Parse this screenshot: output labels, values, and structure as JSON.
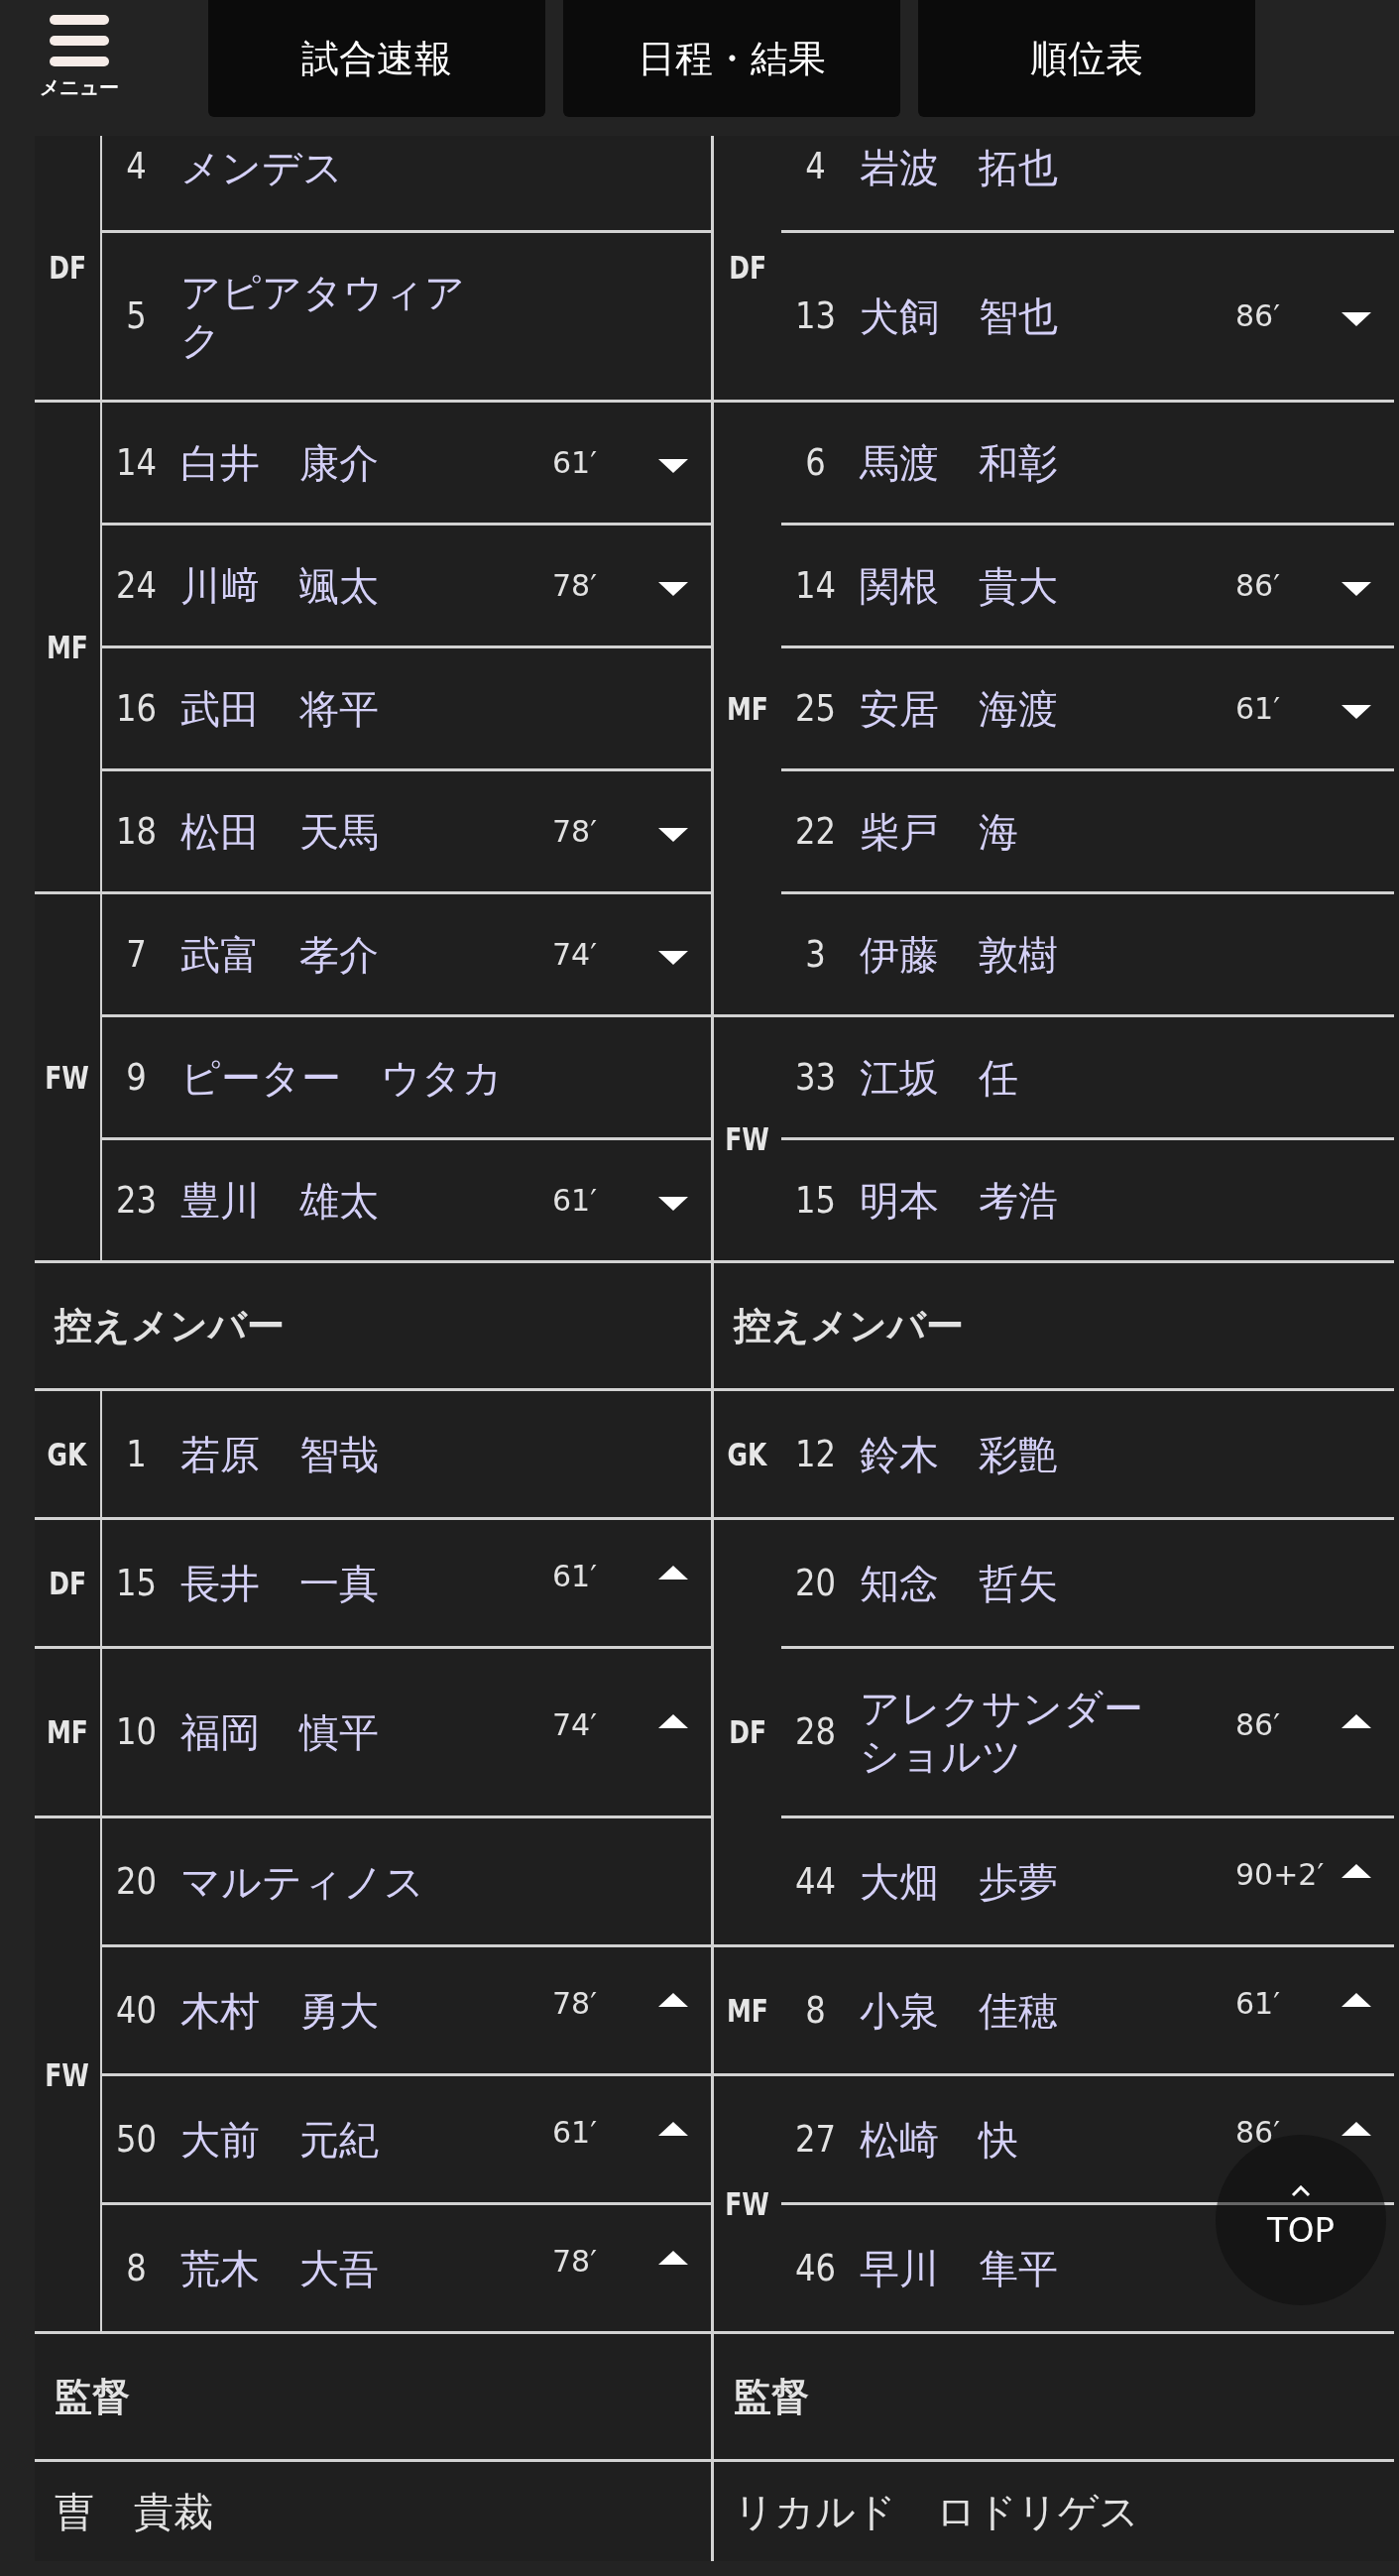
{
  "header": {
    "menu_label": "メニュー",
    "nav": [
      "試合速報",
      "日程・結果",
      "順位表"
    ]
  },
  "teams": [
    {
      "starters": [
        {
          "position": "DF",
          "players": [
            {
              "number": "4",
              "name": "メンデス",
              "substituted": false
            },
            {
              "number": "5",
              "name_lines": [
                "アピアタウィア",
                "ク"
              ],
              "substituted": false
            }
          ]
        },
        {
          "position": "MF",
          "players": [
            {
              "number": "14",
              "name": "白井　康介",
              "minute": "61′",
              "substituted": true
            },
            {
              "number": "24",
              "name": "川﨑　颯太",
              "minute": "78′",
              "substituted": true
            },
            {
              "number": "16",
              "name": "武田　将平",
              "substituted": false
            },
            {
              "number": "18",
              "name": "松田　天馬",
              "minute": "78′",
              "substituted": true
            }
          ]
        },
        {
          "position": "FW",
          "players": [
            {
              "number": "7",
              "name": "武富　孝介",
              "minute": "74′",
              "substituted": true
            },
            {
              "number": "9",
              "name": "ピーター　ウタカ",
              "substituted": false
            },
            {
              "number": "23",
              "name": "豊川　雄太",
              "minute": "61′",
              "substituted": true
            }
          ]
        }
      ],
      "subs_title": "控えメンバー",
      "subs": [
        {
          "position": "GK",
          "players": [
            {
              "number": "1",
              "name": "若原　智哉",
              "substituted": false
            }
          ]
        },
        {
          "position": "DF",
          "players": [
            {
              "number": "15",
              "name": "長井　一真",
              "minute": "61′",
              "substituted": true
            }
          ]
        },
        {
          "position": "MF",
          "players": [
            {
              "number": "10",
              "name": "福岡　慎平",
              "minute": "74′",
              "substituted": true
            }
          ]
        },
        {
          "position": "FW",
          "players": [
            {
              "number": "20",
              "name": "マルティノス",
              "substituted": false
            },
            {
              "number": "40",
              "name": "木村　勇大",
              "minute": "78′",
              "substituted": true
            },
            {
              "number": "50",
              "name": "大前　元紀",
              "minute": "61′",
              "substituted": true
            },
            {
              "number": "8",
              "name": "荒木　大吾",
              "minute": "78′",
              "substituted": true
            }
          ]
        }
      ],
      "manager_title": "監督",
      "manager": "曺　貴裁"
    },
    {
      "starters": [
        {
          "position": "DF",
          "players": [
            {
              "number": "4",
              "name": "岩波　拓也",
              "substituted": false
            },
            {
              "number": "13",
              "name": "犬飼　智也",
              "minute": "86′",
              "substituted": true
            }
          ]
        },
        {
          "position": "MF",
          "players": [
            {
              "number": "6",
              "name": "馬渡　和彰",
              "substituted": false
            },
            {
              "number": "14",
              "name": "関根　貴大",
              "minute": "86′",
              "substituted": true
            },
            {
              "number": "25",
              "name": "安居　海渡",
              "minute": "61′",
              "substituted": true
            },
            {
              "number": "22",
              "name": "柴戸　海",
              "substituted": false
            },
            {
              "number": "3",
              "name": "伊藤　敦樹",
              "substituted": false
            }
          ]
        },
        {
          "position": "FW",
          "players": [
            {
              "number": "33",
              "name": "江坂　任",
              "substituted": false
            },
            {
              "number": "15",
              "name": "明本　考浩",
              "substituted": false
            }
          ]
        }
      ],
      "subs_title": "控えメンバー",
      "subs": [
        {
          "position": "GK",
          "players": [
            {
              "number": "12",
              "name": "鈴木　彩艶",
              "substituted": false
            }
          ]
        },
        {
          "position": "DF",
          "players": [
            {
              "number": "20",
              "name": "知念　哲矢",
              "substituted": false
            },
            {
              "number": "28",
              "name_lines": [
                "アレクサンダー",
                "ショルツ"
              ],
              "minute": "86′",
              "substituted": true
            },
            {
              "number": "44",
              "name": "大畑　歩夢",
              "minute": "90+2′",
              "substituted": true
            }
          ]
        },
        {
          "position": "MF",
          "players": [
            {
              "number": "8",
              "name": "小泉　佳穂",
              "minute": "61′",
              "substituted": true
            }
          ]
        },
        {
          "position": "FW",
          "players": [
            {
              "number": "27",
              "name": "松崎　快",
              "minute": "86′",
              "substituted": true
            },
            {
              "number": "46",
              "name": "早川　隼平",
              "substituted": false
            }
          ]
        }
      ],
      "manager_title": "監督",
      "manager": "リカルド　ロドリゲス"
    }
  ],
  "top_button": "TOP"
}
